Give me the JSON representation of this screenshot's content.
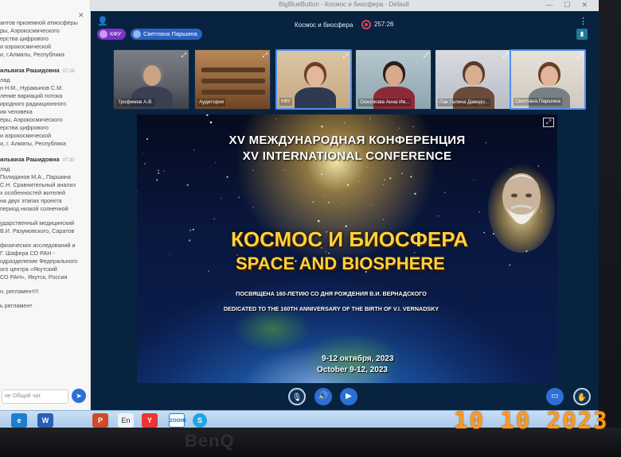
{
  "browser": {
    "title": "BigBlueButton - Космос и биосфера - Default"
  },
  "chat": {
    "lines": [
      {
        "type": "text",
        "text": "антов приземной атмосферы"
      },
      {
        "type": "text",
        "text": "ры, Аэрокосмического"
      },
      {
        "type": "text",
        "text": "ерства цифрового"
      },
      {
        "type": "text",
        "text": "и аэрокосмической"
      },
      {
        "type": "text",
        "text": "и, г.Алматы, Республика"
      },
      {
        "type": "author",
        "text": "ильвиза Рашидовна",
        "time": "07:26"
      },
      {
        "type": "text",
        "text": "лад"
      },
      {
        "type": "text",
        "text": "н Н.М., Нуракынов С.М."
      },
      {
        "type": "text",
        "text": "ление вариаций потока"
      },
      {
        "type": "text",
        "text": "иродного радиационного"
      },
      {
        "type": "text",
        "text": "ия человека"
      },
      {
        "type": "text",
        "text": "еры, Аэрокосмического"
      },
      {
        "type": "text",
        "text": "ерства цифрового"
      },
      {
        "type": "text",
        "text": "и аэрокосмической"
      },
      {
        "type": "text",
        "text": "и, г. Алматы, Республика"
      },
      {
        "type": "author",
        "text": "ильвиза Рашидовна",
        "time": "07:30"
      },
      {
        "type": "text",
        "text": "лад"
      },
      {
        "type": "text",
        "text": "Полиданов М.А., Паршина"
      },
      {
        "type": "text",
        "text": "С.Н. Сравнительный анализ"
      },
      {
        "type": "text",
        "text": "х особенностей жителей"
      },
      {
        "type": "text",
        "text": "на двух этапах проекта"
      },
      {
        "type": "text",
        "text": "период низкой солнечной"
      },
      {
        "type": "gap"
      },
      {
        "type": "text",
        "text": "ударственный медицинский"
      },
      {
        "type": "text",
        "text": "В.И. Разумовского, Саратов"
      },
      {
        "type": "gap"
      },
      {
        "type": "text",
        "text": "физических исследований и"
      },
      {
        "type": "text",
        "text": "Г. Шафера СО РАН -"
      },
      {
        "type": "text",
        "text": "одразделение Федерального"
      },
      {
        "type": "text",
        "text": "ого центра «Якутский"
      },
      {
        "type": "text",
        "text": "СО РАН», Якутск, Россия"
      },
      {
        "type": "gap"
      },
      {
        "type": "text",
        "text": "н, регламент!!!"
      },
      {
        "type": "gap"
      },
      {
        "type": "text",
        "text": "ь регламент"
      }
    ],
    "input_placeholder": "ие Общий чат",
    "send_icon": "send-icon"
  },
  "topbar": {
    "org_pill": "КФУ",
    "user_pill": "Светлана Паршина",
    "meeting_title": "Космос и биосфера",
    "record_time": "257:26"
  },
  "webcams": [
    {
      "name": "Трофимов А.В.",
      "scene": "office-man",
      "active": false
    },
    {
      "name": "Аудитория",
      "scene": "auditorium",
      "active": false
    },
    {
      "name": "КФУ",
      "scene": "woman-glasses",
      "active": true
    },
    {
      "name": "Осколкова Анна Ив...",
      "scene": "woman-dark",
      "active": false
    },
    {
      "name": "Пак Галина Давидо...",
      "scene": "woman-office",
      "active": false
    },
    {
      "name": "Светлана Паршина",
      "scene": "woman-short",
      "active": true
    }
  ],
  "slide": {
    "title_ru": "XV МЕЖДУНАРОДНАЯ КОНФЕРЕНЦИЯ",
    "title_en": "XV INTERNATIONAL CONFERENCE",
    "main_ru": "КОСМОС И БИОСФЕРА",
    "main_en": "SPACE AND BIOSPHERE",
    "dedication_ru": "ПОСВЯЩЕНА 160-ЛЕТИЮ СО ДНЯ РОЖДЕНИЯ В.И. ВЕРНАДСКОГО",
    "dedication_en": "DEDICATED TO THE 160TH ANNIVERSARY OF THE BIRTH OF V.I. VERNADSKY",
    "date_ru": "9-12 октября, 2023",
    "date_en": "October 9-12, 2023"
  },
  "taskbar": {
    "en_label": "En",
    "word_label": "W",
    "ppt_label": "P",
    "y_label": "Y",
    "zoom_label": "zoom",
    "skype_label": "S"
  },
  "monitor": {
    "brand": "BenQ",
    "date_stamp": "10 10 2023"
  },
  "colors": {
    "bbb_bg": "#08233f",
    "accent_blue": "#2e6fd6",
    "slide_title": "#ffd23a",
    "org_pill": "#7b34c8",
    "date_stamp": "#ff9a1a"
  }
}
